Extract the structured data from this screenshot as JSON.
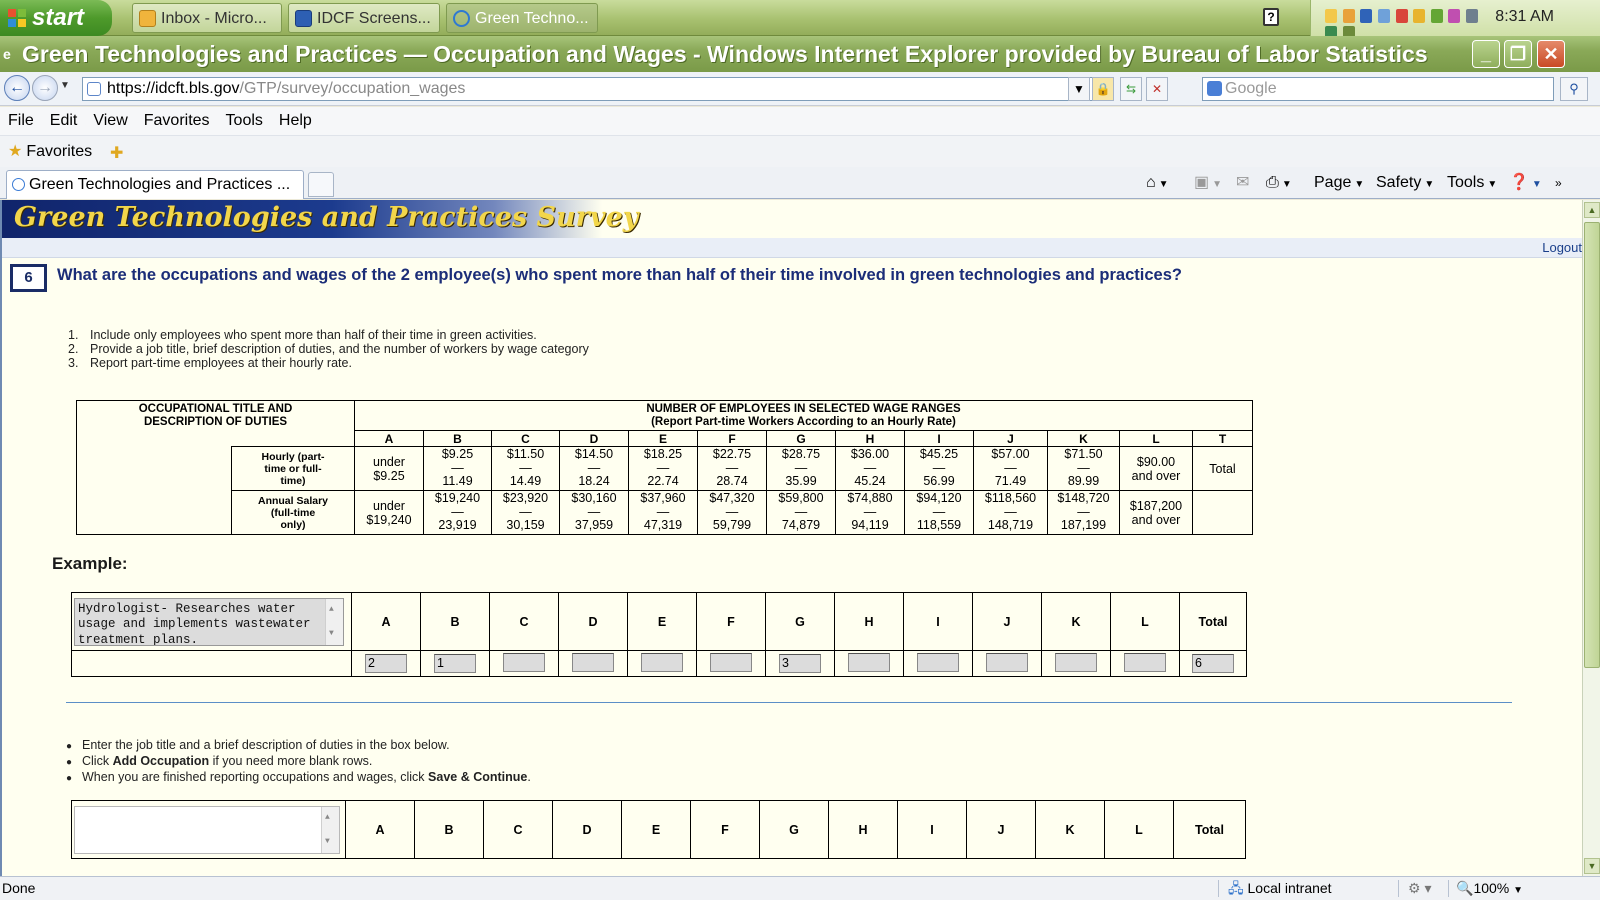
{
  "taskbar": {
    "start_label": "start",
    "tasks": [
      "Inbox - Micro...",
      "IDCF Screens...",
      "Green Techno..."
    ],
    "clock": "8:31 AM"
  },
  "window": {
    "title": "Green Technologies and Practices — Occupation and Wages - Windows Internet Explorer provided by Bureau of Labor Statistics"
  },
  "address": {
    "url_host": "https://idcft.bls.gov",
    "url_path": "/GTP/survey/occupation_wages",
    "search_placeholder": "Google"
  },
  "menu": [
    "File",
    "Edit",
    "View",
    "Favorites",
    "Tools",
    "Help"
  ],
  "favorites_label": "Favorites",
  "tab": {
    "title": "Green Technologies and Practices ..."
  },
  "commands": {
    "page": "Page",
    "safety": "Safety",
    "tools": "Tools"
  },
  "page": {
    "banner": "Green Technologies and Practices Survey",
    "logout": "Logout",
    "question_number": "6",
    "question": "What are the occupations and wages of the 2 employee(s) who spent more than half of their time involved in green technologies and practices?",
    "instructions": [
      "Include only employees who spent more than half of their time in green activities.",
      "Provide a job title, brief description of duties, and the number of workers by wage category",
      "Report part-time employees at their hourly rate."
    ],
    "wage_table": {
      "title_header_1": "OCCUPATIONAL TITLE AND",
      "title_header_2": "DESCRIPTION OF DUTIES",
      "ranges_header_1": "NUMBER OF EMPLOYEES IN SELECTED WAGE RANGES",
      "ranges_header_2": "(Report Part-time Workers According to an Hourly Rate)",
      "columns": [
        "A",
        "B",
        "C",
        "D",
        "E",
        "F",
        "G",
        "H",
        "I",
        "J",
        "K",
        "L",
        "T"
      ],
      "hourly_label_1": "Hourly (part-",
      "hourly_label_2": "time or full-",
      "hourly_label_3": "time)",
      "annual_label_1": "Annual Salary",
      "annual_label_2": "(full-time",
      "annual_label_3": "only)",
      "hourly": [
        [
          "under",
          "$9.25"
        ],
        [
          "$9.25",
          "—",
          "11.49"
        ],
        [
          "$11.50",
          "—",
          "14.49"
        ],
        [
          "$14.50",
          "—",
          "18.24"
        ],
        [
          "$18.25",
          "—",
          "22.74"
        ],
        [
          "$22.75",
          "—",
          "28.74"
        ],
        [
          "$28.75",
          "—",
          "35.99"
        ],
        [
          "$36.00",
          "—",
          "45.24"
        ],
        [
          "$45.25",
          "—",
          "56.99"
        ],
        [
          "$57.00",
          "—",
          "71.49"
        ],
        [
          "$71.50",
          "—",
          "89.99"
        ],
        [
          "$90.00",
          "and over"
        ],
        [
          "Total"
        ]
      ],
      "annual": [
        [
          "under",
          "$19,240"
        ],
        [
          "$19,240",
          "—",
          "23,919"
        ],
        [
          "$23,920",
          "—",
          "30,159"
        ],
        [
          "$30,160",
          "—",
          "37,959"
        ],
        [
          "$37,960",
          "—",
          "47,319"
        ],
        [
          "$47,320",
          "—",
          "59,799"
        ],
        [
          "$59,800",
          "—",
          "74,879"
        ],
        [
          "$74,880",
          "—",
          "94,119"
        ],
        [
          "$94,120",
          "—",
          "118,559"
        ],
        [
          "$118,560",
          "—",
          "148,719"
        ],
        [
          "$148,720",
          "—",
          "187,199"
        ],
        [
          "$187,200",
          "and over"
        ],
        [
          ""
        ]
      ]
    },
    "example_label": "Example:",
    "example": {
      "description": "Hydrologist- Researches water usage and implements wastewater treatment plans.",
      "columns": [
        "A",
        "B",
        "C",
        "D",
        "E",
        "F",
        "G",
        "H",
        "I",
        "J",
        "K",
        "L",
        "Total"
      ],
      "values": [
        "2",
        "1",
        "",
        "",
        "",
        "",
        "3",
        "",
        "",
        "",
        "",
        "",
        "6"
      ]
    },
    "bullets": [
      [
        "Enter the job title and a brief description of duties in the box below.",
        "",
        ""
      ],
      [
        "Click ",
        "Add Occupation",
        " if you need more blank rows."
      ],
      [
        "When you are finished reporting occupations and wages, click ",
        "Save & Continue",
        "."
      ]
    ],
    "entry": {
      "description": "",
      "columns": [
        "A",
        "B",
        "C",
        "D",
        "E",
        "F",
        "G",
        "H",
        "I",
        "J",
        "K",
        "L",
        "Total"
      ]
    }
  },
  "status": {
    "left": "Done",
    "zone": "Local intranet",
    "zoom": "100%"
  }
}
